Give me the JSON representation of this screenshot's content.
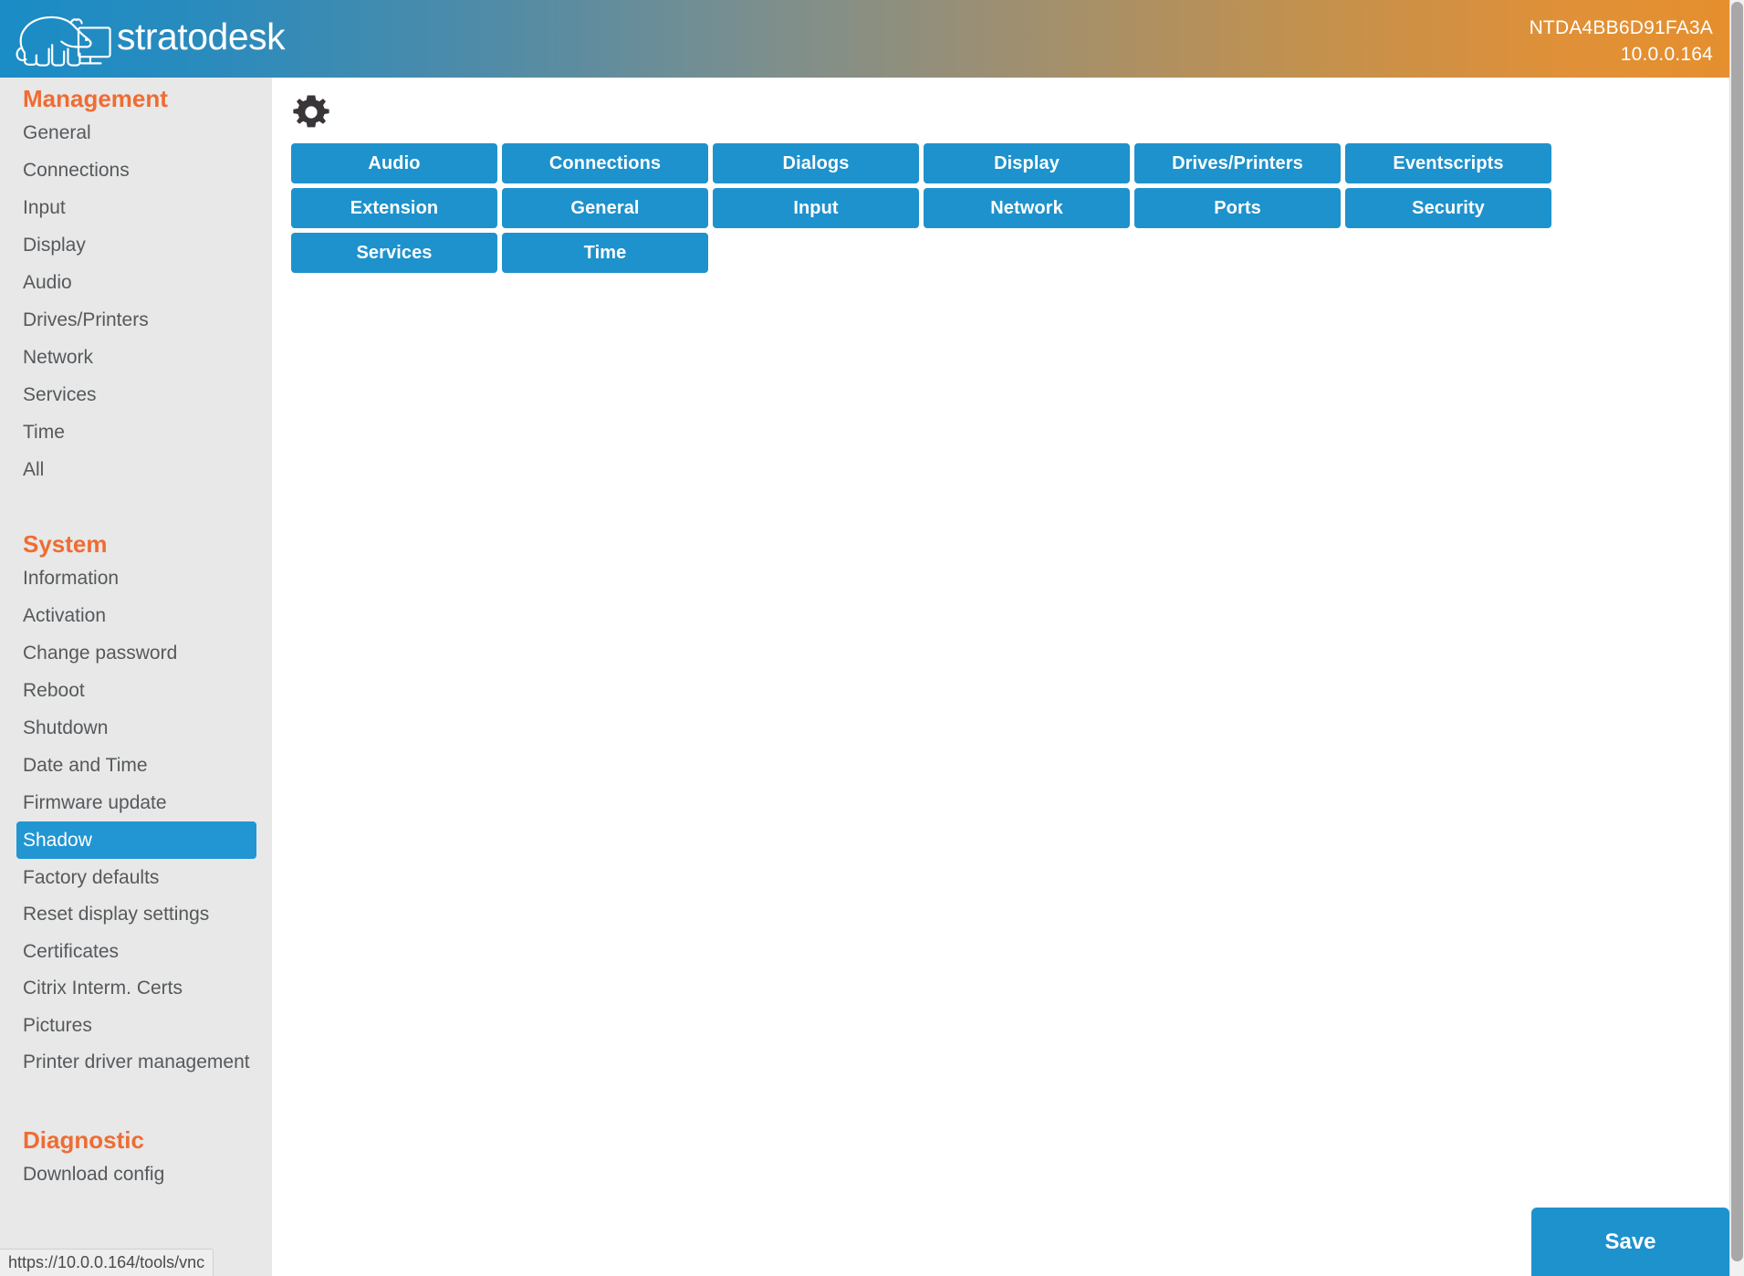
{
  "header": {
    "brand": "stratodesk",
    "logo_icon": "polar-bear-monitor-logo",
    "device_name": "NTDA4BB6D91FA3A",
    "device_ip": "10.0.0.164",
    "gradient_start": "#1a8cc6",
    "gradient_end": "#e58f2e"
  },
  "sidebar": {
    "sections": [
      {
        "title": "Management",
        "items": [
          {
            "label": "General",
            "active": false
          },
          {
            "label": "Connections",
            "active": false
          },
          {
            "label": "Input",
            "active": false
          },
          {
            "label": "Display",
            "active": false
          },
          {
            "label": "Audio",
            "active": false
          },
          {
            "label": "Drives/Printers",
            "active": false
          },
          {
            "label": "Network",
            "active": false
          },
          {
            "label": "Services",
            "active": false
          },
          {
            "label": "Time",
            "active": false
          },
          {
            "label": "All",
            "active": false
          }
        ]
      },
      {
        "title": "System",
        "items": [
          {
            "label": "Information",
            "active": false
          },
          {
            "label": "Activation",
            "active": false
          },
          {
            "label": "Change password",
            "active": false
          },
          {
            "label": "Reboot",
            "active": false
          },
          {
            "label": "Shutdown",
            "active": false
          },
          {
            "label": "Date and Time",
            "active": false
          },
          {
            "label": "Firmware update",
            "active": false
          },
          {
            "label": "Shadow",
            "active": true
          },
          {
            "label": "Factory defaults",
            "active": false
          },
          {
            "label": "Reset display settings",
            "active": false
          },
          {
            "label": "Certificates",
            "active": false
          },
          {
            "label": "Citrix Interm. Certs",
            "active": false
          },
          {
            "label": "Pictures",
            "active": false
          },
          {
            "label": "Printer driver management",
            "active": false
          }
        ]
      },
      {
        "title": "Diagnostic",
        "items": [
          {
            "label": "Download config",
            "active": false
          }
        ]
      }
    ],
    "active_color": "#2196d3",
    "section_title_color": "#ef6c33"
  },
  "main": {
    "settings_icon": "gear-icon",
    "category_buttons": [
      "Audio",
      "Connections",
      "Dialogs",
      "Display",
      "Drives/Printers",
      "Eventscripts",
      "Extension",
      "General",
      "Input",
      "Network",
      "Ports",
      "Security",
      "Services",
      "Time"
    ],
    "button_color": "#1e92cc"
  },
  "footer": {
    "save_label": "Save"
  },
  "status_bar": {
    "url": "https://10.0.0.164/tools/vnc"
  }
}
